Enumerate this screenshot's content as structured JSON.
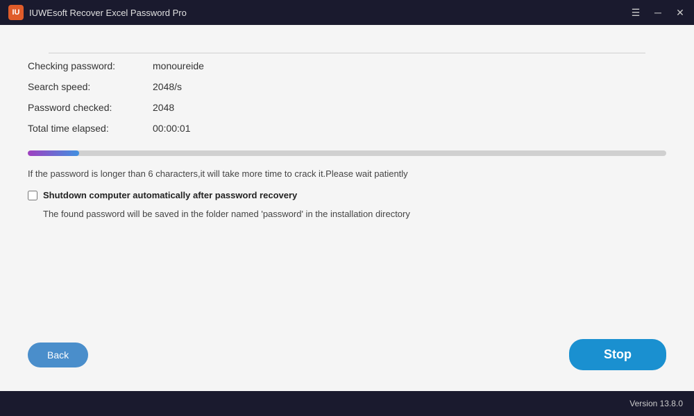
{
  "titlebar": {
    "logo": "IU",
    "title": "IUWEsoft Recover Excel Password Pro",
    "controls": {
      "menu": "☰",
      "minimize": "─",
      "close": "✕"
    }
  },
  "info": {
    "checking_password_label": "Checking password:",
    "checking_password_value": "monoureide",
    "search_speed_label": "Search speed:",
    "search_speed_value": "2048/s",
    "password_checked_label": "Password checked:",
    "password_checked_value": "2048",
    "total_time_label": "Total time elapsed:",
    "total_time_value": "00:00:01"
  },
  "progress": {
    "percent": 8
  },
  "notice_text": "If the password is longer than 6 characters,it will take more time to crack it.Please wait patiently",
  "checkbox": {
    "label": "Shutdown computer automatically after password recovery"
  },
  "save_notice": "The found password will be saved in the folder named 'password' in the installation directory",
  "buttons": {
    "back_label": "Back",
    "stop_label": "Stop"
  },
  "footer": {
    "version": "Version 13.8.0"
  }
}
